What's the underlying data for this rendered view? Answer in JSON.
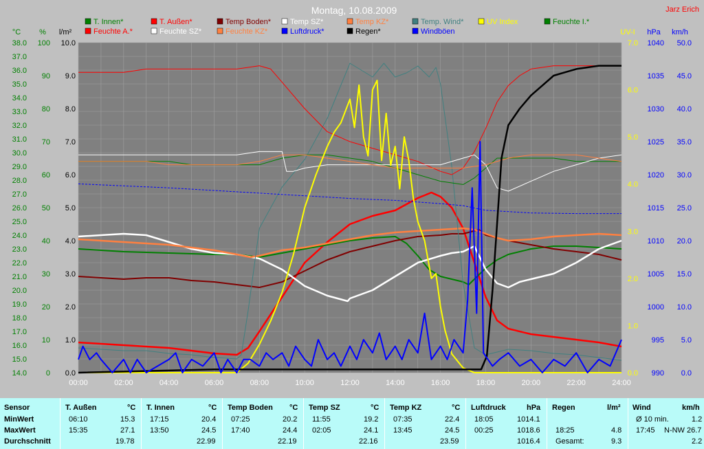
{
  "header": {
    "title": "Montag, 10.08.2009",
    "author": "Jarz Erich"
  },
  "legend": [
    {
      "label": "T. Innen*",
      "color": "#008000"
    },
    {
      "label": "T. Außen*",
      "color": "#ff0000"
    },
    {
      "label": "Temp Boden*",
      "color": "#800000"
    },
    {
      "label": "Temp SZ*",
      "color": "#ffffff"
    },
    {
      "label": "Temp KZ*",
      "color": "#ff8040"
    },
    {
      "label": "Temp. Wind*",
      "color": "#408080"
    },
    {
      "label": "UV Index",
      "color": "#ffff00"
    },
    {
      "label": "Feuchte I.*",
      "color": "#008000"
    },
    {
      "label": "Feuchte A.*",
      "color": "#ff0000"
    },
    {
      "label": "Feuchte SZ*",
      "color": "#ffffff"
    },
    {
      "label": "Feuchte KZ*",
      "color": "#ff8040"
    },
    {
      "label": "Luftdruck*",
      "color": "#0000ff"
    },
    {
      "label": "Regen*",
      "color": "#000000"
    },
    {
      "label": "Windböen",
      "color": "#0000ff"
    }
  ],
  "axes": {
    "temp": {
      "unit": "°C",
      "ticks": [
        "38.0",
        "37.0",
        "36.0",
        "35.0",
        "34.0",
        "33.0",
        "32.0",
        "31.0",
        "30.0",
        "29.0",
        "28.0",
        "27.0",
        "26.0",
        "25.0",
        "24.0",
        "23.0",
        "22.0",
        "21.0",
        "20.0",
        "19.0",
        "18.0",
        "17.0",
        "16.0",
        "15.0",
        "14.0"
      ]
    },
    "hum": {
      "unit": "%",
      "ticks": [
        "100",
        "90",
        "80",
        "70",
        "60",
        "50",
        "40",
        "30",
        "20",
        "10",
        "0"
      ]
    },
    "rain": {
      "unit": "l/m²",
      "ticks": [
        "10.0",
        "9.0",
        "8.0",
        "7.0",
        "6.0",
        "5.0",
        "4.0",
        "3.0",
        "2.0",
        "1.0",
        "0.0"
      ]
    },
    "uv": {
      "unit": "UV-I",
      "ticks": [
        "7.0",
        "6.0",
        "5.0",
        "4.0",
        "3.0",
        "2.0",
        "1.0",
        "0.0"
      ]
    },
    "press": {
      "unit": "hPa",
      "ticks": [
        "1040",
        "1035",
        "1030",
        "1025",
        "1020",
        "1015",
        "1010",
        "1005",
        "1000",
        "995",
        "990"
      ]
    },
    "wind": {
      "unit": "km/h",
      "ticks": [
        "50.0",
        "45.0",
        "40.0",
        "35.0",
        "30.0",
        "25.0",
        "20.0",
        "15.0",
        "10.0",
        "5.0",
        "0.0"
      ]
    },
    "x_ticks": [
      "00:00",
      "02:00",
      "04:00",
      "06:00",
      "08:00",
      "10:00",
      "12:00",
      "14:00",
      "16:00",
      "18:00",
      "20:00",
      "22:00",
      "24:00"
    ]
  },
  "chart_data": {
    "type": "line",
    "title": "Montag, 10.08.2009",
    "x_unit": "hours",
    "xlim": [
      0,
      24
    ],
    "series": [
      {
        "name": "T. Außen*",
        "axis": "temp",
        "color": "#ff0000",
        "width": 2.5,
        "x": [
          0,
          1,
          2,
          3,
          4,
          5,
          6,
          7,
          7.5,
          8,
          9,
          10,
          11,
          12,
          13,
          14,
          15,
          15.6,
          16,
          16.5,
          17,
          17.5,
          18,
          18.5,
          19,
          20,
          21,
          22,
          23,
          24
        ],
        "y": [
          16.2,
          16.1,
          16.0,
          15.9,
          15.8,
          15.6,
          15.4,
          15.3,
          15.8,
          17.0,
          19.5,
          22.0,
          23.5,
          24.8,
          25.4,
          25.8,
          26.7,
          27.1,
          26.8,
          26.0,
          24.5,
          22.0,
          19.5,
          17.8,
          17.2,
          16.8,
          16.6,
          16.4,
          16.2,
          15.9
        ]
      },
      {
        "name": "T. Innen*",
        "axis": "temp",
        "color": "#008000",
        "width": 2,
        "x": [
          0,
          2,
          4,
          6,
          7,
          8,
          9,
          10,
          11,
          12,
          13,
          14,
          14.5,
          15,
          15.5,
          16,
          16.5,
          17,
          17.25,
          17.5,
          18,
          18.5,
          19,
          20,
          21,
          22,
          23,
          24
        ],
        "y": [
          23.0,
          22.8,
          22.7,
          22.6,
          22.6,
          22.4,
          22.7,
          23.0,
          23.3,
          23.6,
          23.8,
          23.9,
          23.4,
          22.5,
          21.5,
          21.0,
          20.8,
          20.6,
          20.4,
          20.8,
          21.6,
          22.2,
          22.6,
          23.0,
          23.2,
          23.2,
          23.1,
          23.0
        ]
      },
      {
        "name": "Temp Boden*",
        "axis": "temp",
        "color": "#800000",
        "width": 2,
        "x": [
          0,
          1,
          2,
          3,
          4,
          5,
          6,
          7,
          7.5,
          8,
          9,
          10,
          11,
          12,
          13,
          14,
          15,
          16,
          16.5,
          17,
          17.7,
          18,
          19,
          20,
          21,
          22,
          23,
          24
        ],
        "y": [
          21.0,
          20.9,
          20.8,
          20.9,
          20.9,
          20.7,
          20.6,
          20.4,
          20.3,
          20.2,
          20.6,
          21.4,
          22.2,
          22.8,
          23.2,
          23.6,
          23.9,
          24.0,
          24.1,
          24.1,
          24.4,
          24.0,
          23.6,
          23.3,
          23.0,
          22.8,
          22.6,
          22.2
        ]
      },
      {
        "name": "Temp SZ*",
        "axis": "temp",
        "color": "#ffffff",
        "width": 2.5,
        "x": [
          0,
          1,
          2,
          3,
          4,
          5,
          6,
          7,
          8,
          9,
          10,
          11,
          11.9,
          12,
          13,
          14,
          15,
          16,
          16.5,
          17,
          17.5,
          18,
          18.5,
          19,
          19.5,
          20,
          21,
          22,
          23,
          24
        ],
        "y": [
          23.9,
          24.0,
          24.1,
          24.0,
          23.5,
          23.0,
          22.7,
          22.6,
          22.3,
          21.5,
          20.3,
          19.6,
          19.2,
          19.4,
          20.0,
          21.0,
          22.0,
          22.5,
          22.7,
          22.8,
          23.2,
          21.5,
          20.5,
          20.2,
          20.6,
          20.8,
          21.2,
          22.0,
          23.0,
          23.6
        ]
      },
      {
        "name": "Temp KZ*",
        "axis": "temp",
        "color": "#ff8040",
        "width": 2.5,
        "x": [
          0,
          1,
          2,
          3,
          4,
          5,
          6,
          7,
          7.6,
          8,
          9,
          10,
          11,
          12,
          13,
          14,
          15,
          16,
          17,
          17.5,
          18,
          18.5,
          19,
          20,
          21,
          22,
          23,
          24
        ],
        "y": [
          23.7,
          23.6,
          23.5,
          23.4,
          23.3,
          23.1,
          22.9,
          22.6,
          22.4,
          22.5,
          22.9,
          23.1,
          23.4,
          23.7,
          24.0,
          24.2,
          24.3,
          24.4,
          24.5,
          24.4,
          24.1,
          23.8,
          23.6,
          23.7,
          23.9,
          24.0,
          24.1,
          24.0
        ]
      },
      {
        "name": "Temp. Wind*",
        "axis": "temp",
        "color": "#408080",
        "width": 1,
        "x": [
          0,
          1,
          2,
          3,
          4,
          5,
          6,
          7,
          7.2,
          7.5,
          8,
          9,
          10,
          10.5,
          11,
          11.5,
          12,
          12.5,
          13,
          13.5,
          14,
          14.5,
          15,
          15.5,
          15.8,
          16,
          16.5,
          17,
          17.5,
          18,
          18.5,
          19,
          20,
          21,
          22,
          23,
          24
        ],
        "y": [
          15.8,
          15.7,
          15.6,
          15.6,
          15.4,
          15.3,
          15.1,
          15.0,
          15.3,
          18.5,
          24.5,
          27.5,
          29.5,
          31.0,
          32.5,
          34.5,
          36.5,
          36.0,
          35.5,
          36.5,
          35.5,
          35.8,
          36.3,
          35.5,
          36.2,
          35.0,
          29.0,
          20.5,
          15.8,
          15.3,
          15.5,
          15.7,
          15.6,
          15.4,
          15.3,
          15.1,
          14.9
        ]
      },
      {
        "name": "Feuchte A.*",
        "axis": "hum",
        "color": "#ff0000",
        "width": 1,
        "x": [
          0,
          1,
          2,
          3,
          4,
          5,
          6,
          7,
          8,
          8.5,
          9,
          10,
          11,
          12,
          13,
          14,
          15,
          16,
          16.5,
          17,
          17.5,
          18,
          18.5,
          19,
          19.5,
          20,
          21,
          22,
          23,
          24
        ],
        "y": [
          91,
          91,
          91,
          92,
          92,
          92,
          92,
          92,
          93,
          92,
          88,
          80,
          73,
          70,
          68,
          66,
          64,
          61,
          60,
          62,
          67,
          74,
          82,
          87,
          90,
          92,
          93,
          93,
          93,
          93
        ]
      },
      {
        "name": "Feuchte I.*",
        "axis": "hum",
        "color": "#008000",
        "width": 1,
        "x": [
          0,
          1,
          2,
          3,
          4,
          5,
          6,
          7,
          8,
          9,
          10,
          11,
          12,
          13,
          14,
          15,
          16,
          17,
          17.5,
          18,
          18.5,
          19,
          20,
          21,
          22,
          23,
          24
        ],
        "y": [
          64,
          64,
          64,
          64,
          64,
          63,
          63,
          63,
          63,
          65,
          66,
          66,
          65,
          64,
          62,
          60,
          58,
          57,
          59,
          62,
          65,
          65,
          65,
          65,
          64,
          64,
          64
        ]
      },
      {
        "name": "Feuchte SZ*",
        "axis": "hum",
        "color": "#ffffff",
        "width": 1,
        "x": [
          0,
          1,
          2,
          3,
          4,
          5,
          6,
          7,
          8,
          9,
          9.2,
          9.5,
          10,
          11,
          12,
          13,
          14,
          15,
          16,
          17,
          17.5,
          18,
          18.5,
          19,
          20,
          21,
          22,
          23,
          24
        ],
        "y": [
          66,
          66,
          66,
          66,
          66,
          66,
          66,
          66,
          67,
          67,
          61,
          61,
          62,
          63,
          63,
          63,
          63,
          63,
          63,
          65,
          66,
          63,
          56,
          55,
          58,
          61,
          63,
          65,
          66
        ]
      },
      {
        "name": "Feuchte KZ*",
        "axis": "hum",
        "color": "#ff8040",
        "width": 1,
        "x": [
          0,
          1,
          2,
          3,
          4,
          5,
          6,
          7,
          8,
          9,
          10,
          11,
          12,
          13,
          14,
          15,
          16,
          17,
          18,
          19,
          20,
          21,
          22,
          23,
          24
        ],
        "y": [
          64,
          64,
          64,
          64,
          63,
          63,
          63,
          63,
          64,
          66,
          66,
          65,
          64,
          63,
          62,
          62,
          62,
          62,
          63,
          65,
          66,
          66,
          66,
          65,
          64
        ]
      },
      {
        "name": "Luftdruck*",
        "axis": "press",
        "color": "#0000ff",
        "width": 1,
        "dash": "3,2",
        "x": [
          0,
          2,
          4,
          6,
          8,
          10,
          12,
          14,
          16,
          17,
          18,
          20,
          22,
          24
        ],
        "y": [
          1018.6,
          1018.3,
          1018.0,
          1017.6,
          1017.2,
          1016.8,
          1016.4,
          1016.1,
          1015.6,
          1015.3,
          1014.6,
          1014.2,
          1014.1,
          1014.1
        ]
      },
      {
        "name": "UV Index",
        "axis": "uv",
        "color": "#ffff00",
        "width": 2,
        "x": [
          0,
          7,
          7.5,
          8,
          8.5,
          9,
          9.5,
          10,
          10.5,
          11,
          11.3,
          11.6,
          12,
          12.2,
          12.4,
          12.6,
          12.8,
          13,
          13.2,
          13.4,
          13.6,
          13.8,
          14,
          14.2,
          14.4,
          14.6,
          14.8,
          15,
          15.3,
          15.6,
          15.8,
          16,
          16.2,
          16.5,
          17,
          17.5,
          24
        ],
        "y": [
          0,
          0,
          0.2,
          0.6,
          1.1,
          1.7,
          2.5,
          3.5,
          4.2,
          4.8,
          5.1,
          5.3,
          5.8,
          5.2,
          6.1,
          5.0,
          4.6,
          6.0,
          6.2,
          4.5,
          5.5,
          4.4,
          4.8,
          3.9,
          5.0,
          4.5,
          3.7,
          3.2,
          2.8,
          2.0,
          2.1,
          1.4,
          0.9,
          0.4,
          0.1,
          0,
          0
        ]
      },
      {
        "name": "Regen*",
        "axis": "rain",
        "color": "#000000",
        "width": 2.5,
        "x": [
          0,
          6,
          17.8,
          18.05,
          18.3,
          18.5,
          18.7,
          19,
          19.5,
          20,
          20.5,
          21,
          21.5,
          22,
          23,
          24
        ],
        "y": [
          0,
          0.1,
          0.1,
          0.5,
          2.5,
          4.5,
          6.5,
          7.5,
          8.0,
          8.4,
          8.7,
          9.0,
          9.1,
          9.2,
          9.3,
          9.3
        ]
      },
      {
        "name": "Windböen",
        "axis": "wind",
        "color": "#0000ff",
        "width": 2,
        "x": [
          0,
          0.2,
          0.5,
          0.8,
          1,
          1.5,
          2,
          2.3,
          2.6,
          3,
          3.5,
          4,
          4.3,
          4.6,
          5,
          5.5,
          6,
          6.3,
          6.6,
          7,
          7.3,
          7.6,
          8,
          8.3,
          8.6,
          9,
          9.3,
          9.6,
          10,
          10.3,
          10.6,
          11,
          11.3,
          11.6,
          12,
          12.3,
          12.6,
          13,
          13.3,
          13.6,
          14,
          14.3,
          14.6,
          15,
          15.3,
          15.6,
          16,
          16.3,
          16.6,
          17,
          17.2,
          17.4,
          17.6,
          17.75,
          17.9,
          18.1,
          18.3,
          18.6,
          19,
          19.5,
          20,
          20.5,
          21,
          21.5,
          22,
          22.5,
          23,
          23.5,
          24
        ],
        "y": [
          2,
          4,
          2,
          3,
          2,
          0,
          2,
          0,
          2,
          0,
          1,
          2,
          3,
          0,
          2,
          1,
          3,
          0,
          2,
          0,
          2,
          2,
          1,
          3,
          2,
          3,
          1,
          4,
          2,
          1,
          5,
          2,
          3,
          1,
          4,
          2,
          5,
          3,
          6,
          2,
          4,
          2,
          5,
          3,
          9,
          2,
          4,
          2,
          5,
          3,
          11,
          28,
          9,
          35,
          3,
          2,
          1,
          2,
          3,
          1,
          2,
          0,
          2,
          1,
          3,
          0,
          2,
          1,
          5
        ]
      }
    ]
  },
  "stats": {
    "headers": {
      "sensor": "Sensor",
      "ta": "T. Außen",
      "ta_unit": "°C",
      "ti": "T. Innen",
      "ti_unit": "°C",
      "tb": "Temp Boden",
      "tb_unit": "°C",
      "tsz": "Temp SZ",
      "tsz_unit": "°C",
      "tkz": "Temp KZ",
      "tkz_unit": "°C",
      "press": "Luftdruck",
      "press_unit": "hPa",
      "rain": "Regen",
      "rain_unit": "l/m²",
      "wind": "Wind",
      "wind_unit": "km/h"
    },
    "rows": {
      "min_label": "MinWert",
      "max_label": "MaxWert",
      "avg_label": "Durchschnitt",
      "ta": {
        "min_t": "06:10",
        "min": "15.3",
        "max_t": "15:35",
        "max": "27.1",
        "avg": "19.78"
      },
      "ti": {
        "min_t": "17:15",
        "min": "20.4",
        "max_t": "13:50",
        "max": "24.5",
        "avg": "22.99"
      },
      "tb": {
        "min_t": "07:25",
        "min": "20.2",
        "max_t": "17:40",
        "max": "24.4",
        "avg": "22.19"
      },
      "tsz": {
        "min_t": "11:55",
        "min": "19.2",
        "max_t": "02:05",
        "max": "24.1",
        "avg": "22.16"
      },
      "tkz": {
        "min_t": "07:35",
        "min": "22.4",
        "max_t": "13:45",
        "max": "24.5",
        "avg": "23.59"
      },
      "press": {
        "min_t": "18:05",
        "min": "1014.1",
        "max_t": "00:25",
        "max": "1018.6",
        "avg": "1016.4"
      },
      "rain": {
        "r1_t": "18:25",
        "r1": "4.8",
        "r2_t": "Gesamt:",
        "r2": "9.3"
      },
      "wind": {
        "r1_t": "Ø 10 min.",
        "r1": "1.2",
        "r2_t": "17:45",
        "r2": "N-NW 26.7",
        "r3": "2.2"
      }
    }
  }
}
